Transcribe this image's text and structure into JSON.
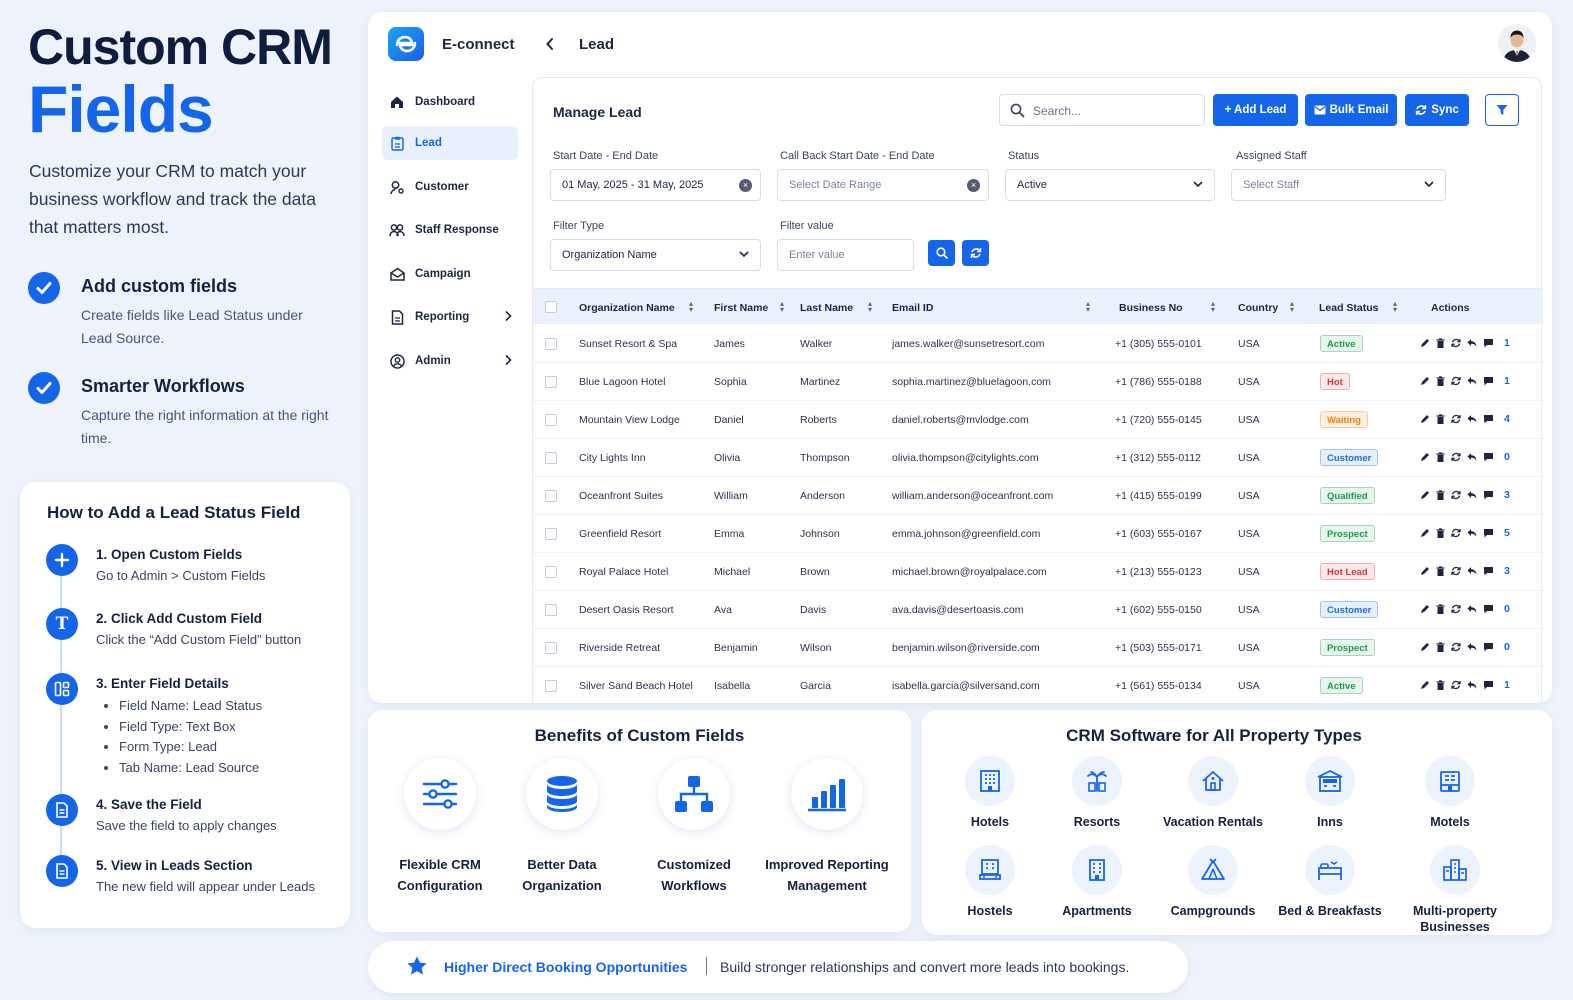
{
  "hero": {
    "title_line1": "Custom CRM",
    "title_line2": "Fields",
    "description": "Customize your CRM to match your business workflow and track the data that matters most."
  },
  "features": [
    {
      "title": "Add custom fields",
      "desc": "Create fields like Lead Status under Lead Source."
    },
    {
      "title": "Smarter Workflows",
      "desc": "Capture the right information at the right time."
    }
  ],
  "howto": {
    "title": "How to Add a Lead Status Field",
    "steps": [
      {
        "title": "1. Open Custom Fields",
        "desc": "Go to Admin > Custom Fields"
      },
      {
        "title": "2. Click Add Custom Field",
        "desc": "Click the “Add Custom Field” button"
      },
      {
        "title": "3. Enter Field Details",
        "bullets": [
          "Field Name: Lead Status",
          "Field Type: Text Box",
          "Form Type: Lead",
          "Tab Name: Lead Source"
        ]
      },
      {
        "title": "4. Save the Field",
        "desc": "Save the field to apply changes"
      },
      {
        "title": "5. View in Leads Section",
        "desc": "The new field will appear under Leads"
      }
    ]
  },
  "app": {
    "brand": "E-connect",
    "back_icon": "chevron-left-icon",
    "breadcrumb": "Lead",
    "nav": [
      {
        "label": "Dashboard",
        "icon": "home-icon"
      },
      {
        "label": "Lead",
        "icon": "clipboard-icon",
        "active": true
      },
      {
        "label": "Customer",
        "icon": "user-key-icon"
      },
      {
        "label": "Staff Response",
        "icon": "users-icon"
      },
      {
        "label": "Campaign",
        "icon": "mail-open-icon"
      },
      {
        "label": "Reporting",
        "icon": "document-icon",
        "submenu": true
      },
      {
        "label": "Admin",
        "icon": "user-circle-icon",
        "submenu": true
      }
    ],
    "panel_title": "Manage Lead",
    "search_placeholder": "Search...",
    "buttons": {
      "add_lead": "+ Add Lead",
      "bulk_email": "Bulk Email",
      "sync": "Sync"
    },
    "filters": {
      "date_label": "Start Date - End Date",
      "date_value": "01 May, 2025 - 31 May, 2025",
      "callback_label": "Call Back Start Date - End Date",
      "callback_placeholder": "Select Date Range",
      "status_label": "Status",
      "status_value": "Active",
      "staff_label": "Assigned Staff",
      "staff_placeholder": "Select Staff",
      "filter_type_label": "Filter Type",
      "filter_type_value": "Organization Name",
      "filter_value_label": "Filter value",
      "filter_value_placeholder": "Enter value"
    },
    "columns": [
      "Organization Name",
      "First Name",
      "Last Name",
      "Email ID",
      "Business No",
      "Country",
      "Lead Status",
      "Actions"
    ],
    "rows": [
      {
        "org": "Sunset Resort & Spa",
        "first": "James",
        "last": "Walker",
        "email": "james.walker@sunsetresort.com",
        "phone": "+1 (305) 555-0101",
        "country": "USA",
        "status": "Active",
        "count": "1"
      },
      {
        "org": "Blue Lagoon Hotel",
        "first": "Sophia",
        "last": "Martinez",
        "email": "sophia.martinez@bluelagoon.com",
        "phone": "+1 (786) 555-0188",
        "country": "USA",
        "status": "Hot",
        "count": "1"
      },
      {
        "org": "Mountain View Lodge",
        "first": "Daniel",
        "last": "Roberts",
        "email": "daniel.roberts@mvlodge.com",
        "phone": "+1 (720) 555-0145",
        "country": "USA",
        "status": "Waiting",
        "count": "4"
      },
      {
        "org": "City Lights Inn",
        "first": "Olivia",
        "last": "Thompson",
        "email": "olivia.thompson@citylights.com",
        "phone": "+1 (312) 555-0112",
        "country": "USA",
        "status": "Customer",
        "count": "0"
      },
      {
        "org": "Oceanfront Suites",
        "first": "William",
        "last": "Anderson",
        "email": "william.anderson@oceanfront.com",
        "phone": "+1 (415) 555-0199",
        "country": "USA",
        "status": "Qualified",
        "count": "3"
      },
      {
        "org": "Greenfield Resort",
        "first": "Emma",
        "last": "Johnson",
        "email": "emma.johnson@greenfield.com",
        "phone": "+1 (603) 555-0167",
        "country": "USA",
        "status": "Prospect",
        "count": "5"
      },
      {
        "org": "Royal Palace Hotel",
        "first": "Michael",
        "last": "Brown",
        "email": "michael.brown@royalpalace.com",
        "phone": "+1 (213) 555-0123",
        "country": "USA",
        "status": "Hot Lead",
        "count": "3"
      },
      {
        "org": "Desert Oasis Resort",
        "first": "Ava",
        "last": "Davis",
        "email": "ava.davis@desertoasis.com",
        "phone": "+1 (602) 555-0150",
        "country": "USA",
        "status": "Customer",
        "count": "0"
      },
      {
        "org": "Riverside Retreat",
        "first": "Benjamin",
        "last": "Wilson",
        "email": "benjamin.wilson@riverside.com",
        "phone": "+1 (503) 555-0171",
        "country": "USA",
        "status": "Prospect",
        "count": "0"
      },
      {
        "org": "Silver Sand Beach Hotel",
        "first": "Isabella",
        "last": "Garcia",
        "email": "isabella.garcia@silversand.com",
        "phone": "+1 (561) 555-0134",
        "country": "USA",
        "status": "Active",
        "count": "1"
      }
    ],
    "status_colors": {
      "Active": "#1e9a4a",
      "Hot": "#e0353b",
      "Waiting": "#e8850c",
      "Customer": "#1f6fe0",
      "Qualified": "#1e9a4a",
      "Prospect": "#1e9a4a",
      "Hot Lead": "#e0353b"
    }
  },
  "benefits": {
    "title": "Benefits of Custom Fields",
    "items": [
      {
        "label": "Flexible CRM Configuration",
        "icon": "sliders-icon"
      },
      {
        "label": "Better Data Organization",
        "icon": "database-icon"
      },
      {
        "label": "Customized Workflows",
        "icon": "hierarchy-icon"
      },
      {
        "label": "Improved Reporting Management",
        "icon": "bar-chart-icon"
      }
    ]
  },
  "properties": {
    "title": "CRM Software for All Property Types",
    "items": [
      {
        "label": "Hotels",
        "icon": "hotel-icon"
      },
      {
        "label": "Resorts",
        "icon": "palm-tree-icon"
      },
      {
        "label": "Vacation Rentals",
        "icon": "house-icon"
      },
      {
        "label": "Inns",
        "icon": "inn-icon"
      },
      {
        "label": "Motels",
        "icon": "motel-icon"
      },
      {
        "label": "Hostels",
        "icon": "hostel-icon"
      },
      {
        "label": "Apartments",
        "icon": "apartment-icon"
      },
      {
        "label": "Campgrounds",
        "icon": "tent-icon"
      },
      {
        "label": "Bed & Breakfasts",
        "icon": "bed-icon"
      },
      {
        "label": "Multi-property Businesses",
        "icon": "buildings-icon"
      }
    ]
  },
  "banner": {
    "title": "Higher Direct Booking Opportunities",
    "desc": "Build stronger relationships and convert more leads into bookings."
  },
  "accent_color": "#1565e8"
}
